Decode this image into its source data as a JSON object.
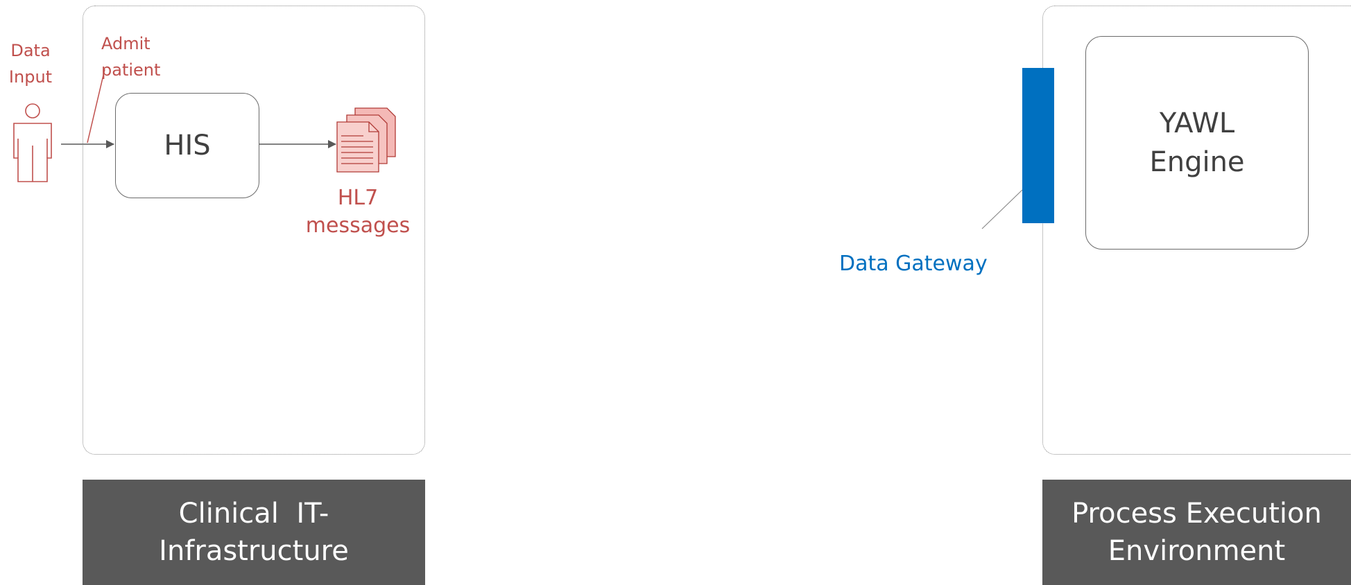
{
  "actor": {
    "label_line1": "Data",
    "label_line2": "Input"
  },
  "admit": {
    "line1": "Admit",
    "line2": "patient"
  },
  "his": {
    "label": "HIS"
  },
  "messages": {
    "line1": "HL7",
    "line2": "messages"
  },
  "gateway": {
    "label": "Data Gateway"
  },
  "engine": {
    "line1": "YAWL",
    "line2": "Engine"
  },
  "footers": {
    "left": {
      "line1": "Clinical  IT-",
      "line2": "Infrastructure"
    },
    "right": {
      "line1": "Process Execution",
      "line2": "Environment"
    }
  },
  "colors": {
    "accent_red": "#c0504d",
    "gateway_blue": "#0070c0",
    "footer_gray": "#595959"
  },
  "icons": [
    "person-icon",
    "document-stack-icon"
  ]
}
